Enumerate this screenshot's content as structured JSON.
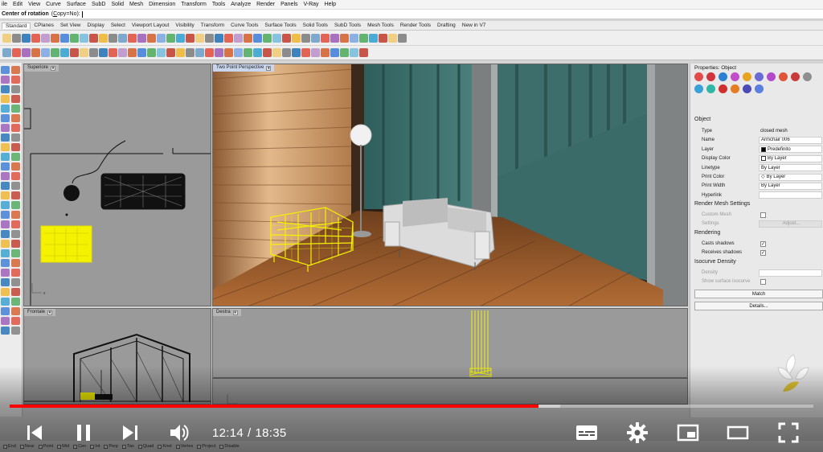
{
  "menu": [
    "ile",
    "Edit",
    "View",
    "Curve",
    "Surface",
    "SubD",
    "Solid",
    "Mesh",
    "Dimension",
    "Transform",
    "Tools",
    "Analyze",
    "Render",
    "Panels",
    "V-Ray",
    "Help"
  ],
  "command": {
    "prompt": "Center of rotation",
    "option_open": "(",
    "option_key": "C",
    "option_rest": "opy=No",
    "option_close": "):"
  },
  "tabs": [
    {
      "label": "Standard",
      "active": true
    },
    {
      "label": "CPlanes"
    },
    {
      "label": "Set View"
    },
    {
      "label": "Display"
    },
    {
      "label": "Select"
    },
    {
      "label": "Viewport Layout"
    },
    {
      "label": "Visibility"
    },
    {
      "label": "Transform"
    },
    {
      "label": "Curve Tools"
    },
    {
      "label": "Surface Tools"
    },
    {
      "label": "Solid Tools"
    },
    {
      "label": "SubD Tools"
    },
    {
      "label": "Mesh Tools"
    },
    {
      "label": "Render Tools"
    },
    {
      "label": "Drafting"
    },
    {
      "label": "New in V7"
    }
  ],
  "viewports": {
    "top": "Superiore",
    "perspective": "Two Point Perspective",
    "front": "Frontale",
    "right": "Destra"
  },
  "properties": {
    "title": "Properties: Object",
    "section_object": "Object",
    "rows": [
      {
        "label": "Type",
        "value": "closed mesh",
        "kind": "plain"
      },
      {
        "label": "Name",
        "value": "Armchair 006",
        "kind": "field"
      },
      {
        "label": "Layer",
        "value": "Predefinito",
        "kind": "swatch",
        "swatch": "#000000"
      },
      {
        "label": "Display Color",
        "value": "By Layer",
        "kind": "swatch",
        "swatch": "#ffffff"
      },
      {
        "label": "Linetype",
        "value": "By Layer",
        "kind": "field"
      },
      {
        "label": "Print Color",
        "value": "By Layer",
        "kind": "diamond"
      },
      {
        "label": "Print Width",
        "value": "By Layer",
        "kind": "field"
      },
      {
        "label": "Hyperlink",
        "value": "",
        "kind": "field"
      }
    ],
    "section_render_mesh": "Render Mesh Settings",
    "custom_mesh": "Custom Mesh",
    "settings": "Settings",
    "adjust": "Adjust...",
    "section_rendering": "Rendering",
    "casts_shadows": "Casts shadows",
    "receives_shadows": "Receives shadows",
    "section_isocurve": "Isocurve Density",
    "density": "Density",
    "show_isocurve": "Show surface isocurve",
    "match": "Match",
    "details": "Details..."
  },
  "status_snaps": [
    "End",
    "Near",
    "Point",
    "Mid",
    "Cen",
    "Int",
    "Perp",
    "Tan",
    "Quad",
    "Knot",
    "Vertex",
    "Project",
    "Disable"
  ],
  "status_tabs": "nt Perspective  Superiore  Frontale  Destra",
  "video": {
    "current": "12:14",
    "sep": "/",
    "duration": "18:35",
    "played_fraction": 0.658,
    "loaded_fraction": 0.685
  },
  "colors": {
    "accent_red": "#ff0000",
    "selection_yellow": "#f5f200",
    "wall_teal": "#3e6e6c",
    "floor_wood": "#9a5b2c"
  }
}
